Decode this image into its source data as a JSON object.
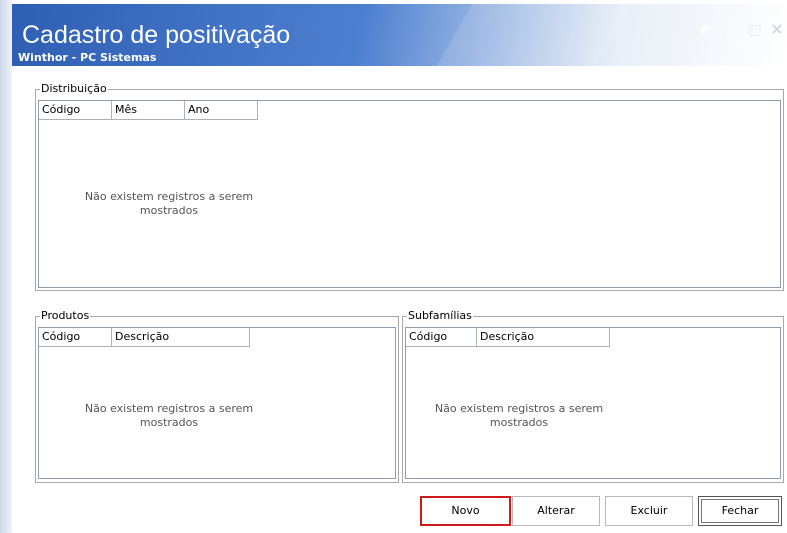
{
  "window": {
    "title": "Cadastro de positivação",
    "subtitle": "Winthor - PC Sistemas",
    "controls": {
      "restore": "◩",
      "minimize": "_",
      "maximize": "□",
      "close": "✕"
    }
  },
  "distribuicao": {
    "label": "Distribuição",
    "columns": [
      "Código",
      "Mês",
      "Ano"
    ],
    "empty_message": "Não existem registros a serem\nmostrados"
  },
  "produtos": {
    "label": "Produtos",
    "columns": [
      "Código",
      "Descrição"
    ],
    "empty_message": "Não existem registros a serem\nmostrados"
  },
  "subfamilias": {
    "label": "Subfamílias",
    "columns": [
      "Código",
      "Descrição"
    ],
    "empty_message": "Não existem registros a serem\nmostrados"
  },
  "buttons": {
    "novo": "Novo",
    "alterar": "Alterar",
    "excluir": "Excluir",
    "fechar": "Fechar"
  },
  "colors": {
    "titlebar_start": "#2f5fb3",
    "highlight_border": "#d11b1b"
  }
}
